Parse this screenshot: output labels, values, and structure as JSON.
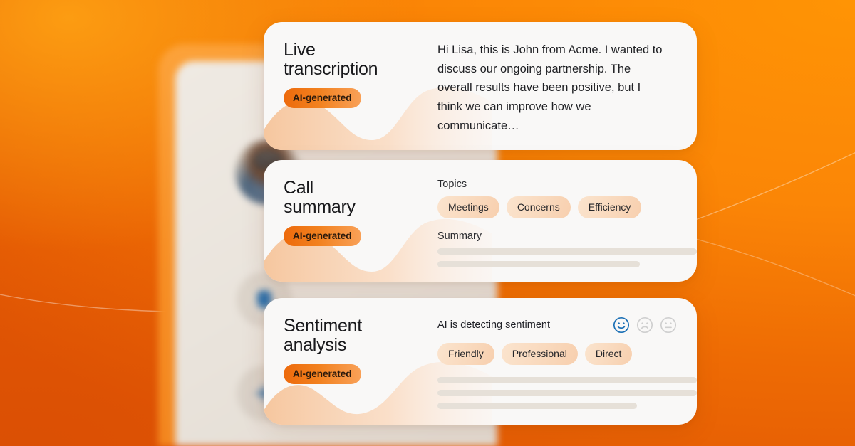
{
  "theme": {
    "bg_orange_light": "#FF9405",
    "bg_orange_mid": "#F58305",
    "bg_orange_deep": "#E25704",
    "badge_gradient_start": "#ED6A0C",
    "badge_gradient_end": "#F9A158",
    "pill_peach": "#F9D9BD",
    "skeleton_grey": "#E6E0D8",
    "accent_blue": "#1A6FB5",
    "face_inactive_grey": "#CFCFCF",
    "text_dark": "#18181B"
  },
  "phone": {
    "avatar_name": "caller-avatar",
    "buttons": [
      {
        "name": "microphone-button",
        "icon": "microphone-icon"
      },
      {
        "name": "sparkle-button",
        "icon": "sparkle-icon"
      }
    ]
  },
  "cards": [
    {
      "id": "live-transcription",
      "title": "Live\ntranscription",
      "badge": "AI-generated",
      "transcript": "Hi Lisa, this is John from Acme. I wanted to discuss our ongoing partnership. The overall results have been positive, but I think we can improve how we communicate…"
    },
    {
      "id": "call-summary",
      "title": "Call\nsummary",
      "badge": "AI-generated",
      "topics_label": "Topics",
      "topics": [
        "Meetings",
        "Concerns",
        "Efficiency"
      ],
      "summary_label": "Summary",
      "summary_lines": [
        100,
        78
      ]
    },
    {
      "id": "sentiment-analysis",
      "title": "Sentiment\nanalysis",
      "badge": "AI-generated",
      "status": "AI is detecting sentiment",
      "faces": [
        {
          "name": "happy-face-icon",
          "mood": "happy",
          "selected": true
        },
        {
          "name": "sad-face-icon",
          "mood": "sad",
          "selected": false
        },
        {
          "name": "neutral-face-icon",
          "mood": "neutral",
          "selected": false
        }
      ],
      "tags": [
        "Friendly",
        "Professional",
        "Direct"
      ],
      "detail_lines": [
        100,
        100,
        77
      ]
    }
  ]
}
